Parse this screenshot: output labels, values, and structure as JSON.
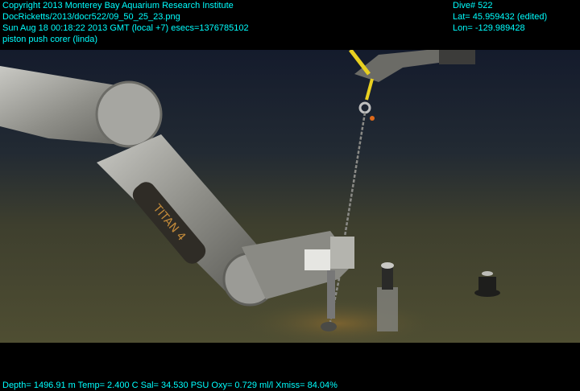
{
  "overlay": {
    "copyright": "Copyright 2013 Monterey Bay Aquarium Research Institute",
    "file_path": "DocRicketts/2013/docr522/09_50_25_23.png",
    "timestamp": "Sun Aug 18 00:18:22 2013 GMT (local +7)  esecs=1376785102",
    "tool": "piston push corer (linda)",
    "dive": "Dive# 522",
    "lat": "Lat= 45.959432 (edited)",
    "lon": "Lon= -129.989428",
    "telemetry": "Depth= 1496.91 m  Temp= 2.400 C  Sal= 34.530 PSU  Oxy= 0.729 ml/l  Xmiss= 84.04%"
  },
  "scene": {
    "arm_brand": "TITAN 4"
  },
  "colors": {
    "overlay_text": "#00ffff",
    "seafloor": "#4a4a32",
    "water": "#1a2235"
  }
}
